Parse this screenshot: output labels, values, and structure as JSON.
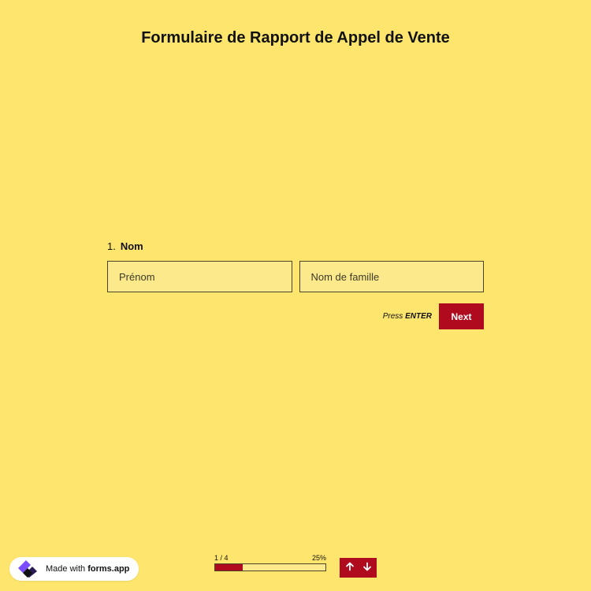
{
  "form": {
    "title": "Formulaire de Rapport de Appel de Vente"
  },
  "question": {
    "number": "1.",
    "label": "Nom",
    "first_name_placeholder": "Prénom",
    "last_name_placeholder": "Nom de famille",
    "first_name_value": "",
    "last_name_value": ""
  },
  "actions": {
    "hint_prefix": "Press",
    "hint_key": "ENTER",
    "next_label": "Next"
  },
  "progress": {
    "step_text": "1 / 4",
    "percent_text": "25%",
    "fraction": 0.25
  },
  "badge": {
    "prefix": "Made with",
    "brand": "forms.app"
  },
  "colors": {
    "background": "#fee66e",
    "accent": "#b00a1e",
    "field_background": "#fbe98c"
  },
  "icons": {
    "up": "arrow-up-icon",
    "down": "arrow-down-icon",
    "logo": "forms-app-logo-icon"
  }
}
